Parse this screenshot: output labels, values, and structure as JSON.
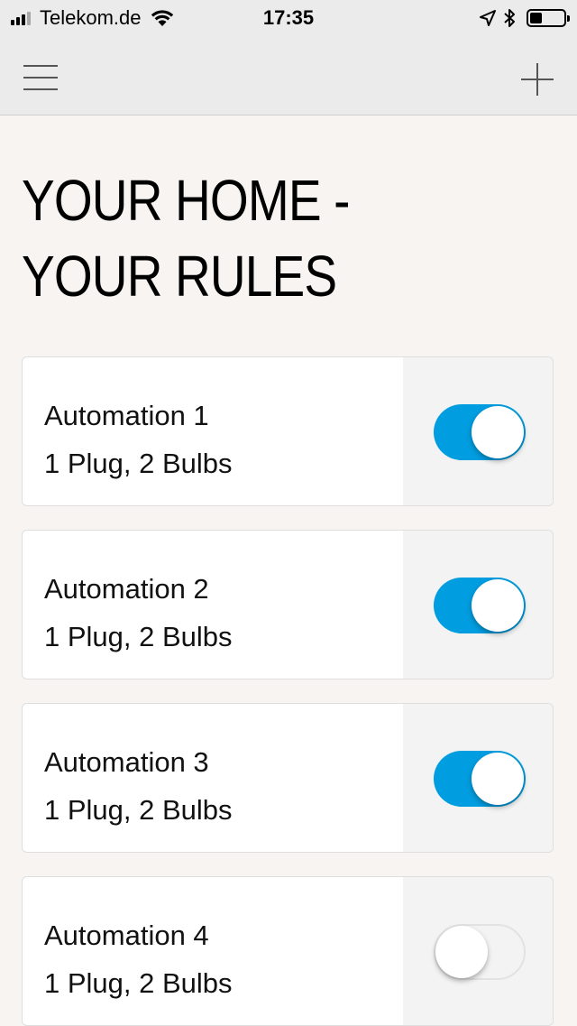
{
  "status_bar": {
    "carrier": "Telekom.de",
    "time": "17:35",
    "signal_bars": 4,
    "signal_bars_active": 3,
    "battery_level": 0.35
  },
  "nav": {
    "menu_icon": "hamburger-menu-icon",
    "add_icon": "plus-icon"
  },
  "page": {
    "title_line1": "YOUR HOME -",
    "title_line2": "YOUR RULES"
  },
  "colors": {
    "accent": "#009de0",
    "background": "#f7f4f1",
    "nav_background": "#ebebeb"
  },
  "automations": [
    {
      "name": "Automation 1",
      "description": "1 Plug, 2 Bulbs",
      "enabled": true
    },
    {
      "name": "Automation 2",
      "description": "1 Plug, 2 Bulbs",
      "enabled": true
    },
    {
      "name": "Automation 3",
      "description": "1 Plug, 2 Bulbs",
      "enabled": true
    },
    {
      "name": "Automation 4",
      "description": "1 Plug, 2 Bulbs",
      "enabled": false
    }
  ]
}
